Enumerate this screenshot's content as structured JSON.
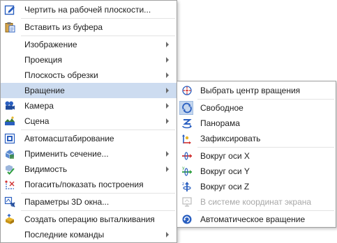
{
  "main_menu": {
    "items": [
      {
        "label": "Чертить на рабочей плоскости...",
        "icon": "sketch-on-plane-icon",
        "arrow": false
      },
      {
        "label": "Вставить из буфера",
        "icon": "paste-icon",
        "arrow": false
      },
      {
        "label": "Изображение",
        "icon": "",
        "arrow": true
      },
      {
        "label": "Проекция",
        "icon": "",
        "arrow": true
      },
      {
        "label": "Плоскость обрезки",
        "icon": "",
        "arrow": true
      },
      {
        "label": "Вращение",
        "icon": "",
        "arrow": true,
        "highlighted": true
      },
      {
        "label": "Камера",
        "icon": "camera-icon",
        "arrow": true
      },
      {
        "label": "Сцена",
        "icon": "scene-icon",
        "arrow": true
      },
      {
        "label": "Автомасштабирование",
        "icon": "autoscale-icon",
        "arrow": false
      },
      {
        "label": "Применить сечение...",
        "icon": "section-icon",
        "arrow": true
      },
      {
        "label": "Видимость",
        "icon": "visibility-icon",
        "arrow": true
      },
      {
        "label": "Погасить/показать построения",
        "icon": "hide-constructions-icon",
        "arrow": false
      },
      {
        "label": "Параметры 3D окна...",
        "icon": "3d-window-params-icon",
        "arrow": false
      },
      {
        "label": "Создать операцию выталкивания",
        "icon": "extrude-icon",
        "arrow": false
      },
      {
        "label": "Последние команды",
        "icon": "",
        "arrow": true
      }
    ]
  },
  "rotation_submenu": {
    "items": [
      {
        "label": "Выбрать центр вращения",
        "icon": "rotation-center-icon"
      },
      {
        "label": "Свободное",
        "icon": "free-rotation-icon",
        "checked": true
      },
      {
        "label": "Панорама",
        "icon": "panorama-icon"
      },
      {
        "label": "Зафиксировать",
        "icon": "fix-icon"
      },
      {
        "label": "Вокруг оси X",
        "icon": "axis-x-icon"
      },
      {
        "label": "Вокруг оси Y",
        "icon": "axis-y-icon"
      },
      {
        "label": "Вокруг оси Z",
        "icon": "axis-z-icon"
      },
      {
        "label": "В системе координат экрана",
        "icon": "screen-coords-icon",
        "disabled": true
      },
      {
        "label": "Автоматическое вращение",
        "icon": "auto-rotation-icon"
      }
    ]
  },
  "colors": {
    "highlight": "#cddcf0",
    "checked_box": "#c4d6ee",
    "axis_x": "#d03030",
    "axis_y": "#2e9e3e",
    "axis_z": "#2a5fc0"
  }
}
